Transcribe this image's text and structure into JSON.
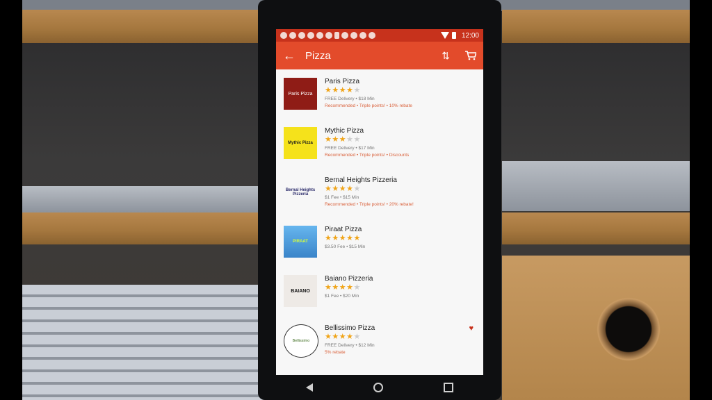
{
  "status_bar": {
    "time": "12:00"
  },
  "appbar": {
    "title": "Pizza"
  },
  "restaurants": [
    {
      "name": "Paris Pizza",
      "rating": 4.5,
      "logo_text": "Paris Pizza",
      "meta": "FREE Delivery  •  $18 Min",
      "tags": "Recommended  •  Triple points!  •  10% rebate",
      "favorite": false
    },
    {
      "name": "Mythic Pizza",
      "rating": 3.5,
      "logo_text": "Mythic Pizza",
      "meta": "FREE Delivery  •  $17 Min",
      "tags": "Recommended  •  Triple points!  •  Discounts",
      "favorite": false
    },
    {
      "name": "Bernal Heights Pizzeria",
      "rating": 4.0,
      "logo_text": "Bernal Heights Pizzeria",
      "meta": "$1 Fee  •  $15 Min",
      "tags": "Recommended  •  Triple points!  •  20% rebate!",
      "favorite": false
    },
    {
      "name": "Piraat Pizza",
      "rating": 5.0,
      "logo_text": "PIRAAT",
      "meta": "$3.50 Fee  •  $15 Min",
      "tags": "",
      "favorite": false
    },
    {
      "name": "Baiano Pizzeria",
      "rating": 4.5,
      "logo_text": "BAIANO",
      "meta": "$1 Fee  •  $20 Min",
      "tags": "",
      "favorite": false
    },
    {
      "name": "Bellissimo Pizza",
      "rating": 4.0,
      "logo_text": "Bellissimo",
      "meta": "FREE Delivery  •  $12 Min",
      "tags": "5% rebate",
      "favorite": true
    }
  ],
  "colors": {
    "status": "#c7321c",
    "appbar": "#e34b2b",
    "star": "#f0a417",
    "tag": "#d9603a"
  },
  "icons": {
    "back": "arrow-left-icon",
    "sort": "sort-icon",
    "cart": "cart-icon",
    "heart": "heart-icon"
  }
}
